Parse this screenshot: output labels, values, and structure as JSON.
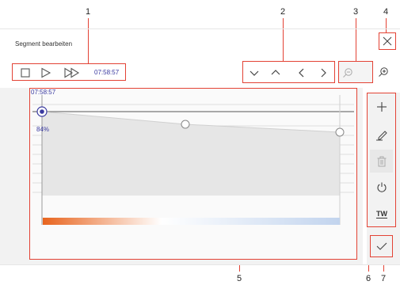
{
  "callouts": [
    "1",
    "2",
    "3",
    "4",
    "5",
    "6",
    "7"
  ],
  "dialog": {
    "title": "Segment bearbeiten"
  },
  "toolbar": {
    "time": "07:58:57"
  },
  "chart": {
    "time_label": "07:58:57",
    "level_label": "84%"
  },
  "side_panel": {
    "tw_label": "TW"
  },
  "icons": {
    "stop": "stop-icon",
    "play": "play-icon",
    "fast_forward": "fast-forward-icon",
    "chevron_down": "chevron-down-icon",
    "chevron_up": "chevron-up-icon",
    "chevron_left": "chevron-left-icon",
    "chevron_right": "chevron-right-icon",
    "zoom_out": "zoom-out-icon",
    "zoom_in": "zoom-in-icon",
    "close": "close-icon",
    "add": "add-icon",
    "edit": "pencil-icon",
    "delete": "trash-icon",
    "power": "power-icon",
    "confirm": "checkmark-icon"
  },
  "colors": {
    "callout": "#e34234",
    "time_text": "#3a3aa0",
    "gradient_start": "#e8641e",
    "gradient_end": "#c2d4ee"
  }
}
